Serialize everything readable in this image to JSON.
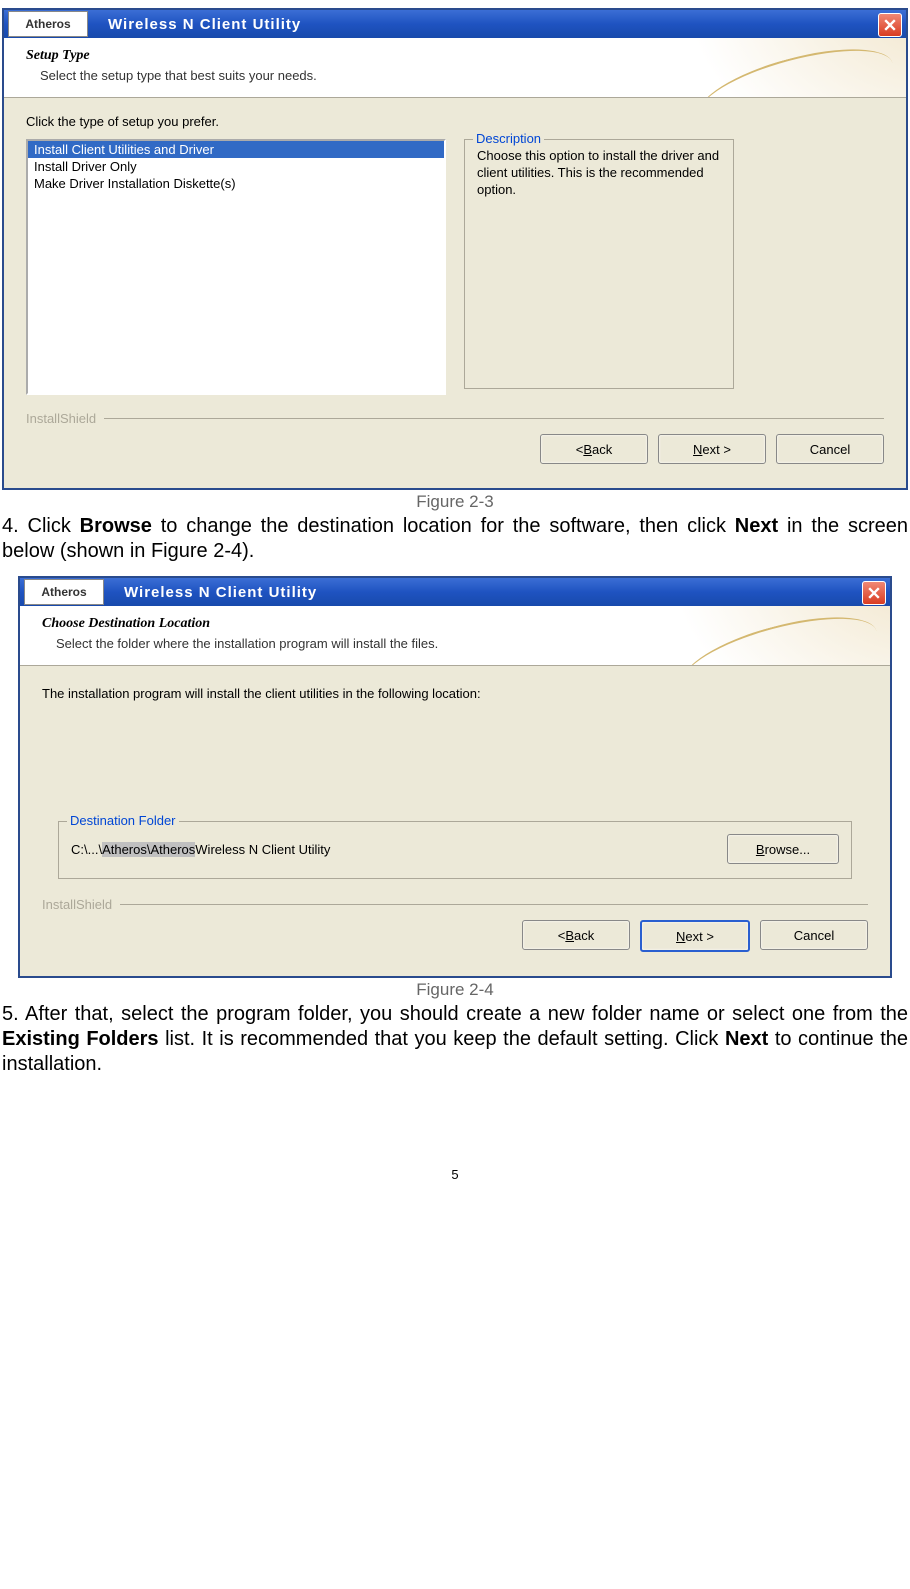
{
  "dialog1": {
    "brand": "Atheros",
    "title": "Wireless N Client Utility",
    "header_title": "Setup Type",
    "header_sub": "Select the setup type that best suits your needs.",
    "instruction": "Click the type of setup you prefer.",
    "options": {
      "opt0": "Install Client Utilities and Driver",
      "opt1": "Install Driver Only",
      "opt2": "Make Driver Installation Diskette(s)"
    },
    "desc_legend": "Description",
    "desc_text": "Choose this option to install the driver and client utilities. This is the recommended option.",
    "installshield": "InstallShield",
    "back_u": "B",
    "back_rest": "ack",
    "next_u": "N",
    "next_rest": "ext >",
    "cancel": "Cancel"
  },
  "fig1": "Figure 2-3",
  "para1_pre": "4. Click ",
  "para1_b1": "Browse",
  "para1_mid": " to change the destination location for the software, then click ",
  "para1_b2": "Next",
  "para1_post": " in the screen below (shown in Figure 2-4).",
  "dialog2": {
    "brand": "Atheros",
    "title": "Wireless N Client Utility",
    "header_title": "Choose Destination Location",
    "header_sub": "Select the folder where the installation program will install the files.",
    "instruction": "The installation program will install the client utilities in the following location:",
    "dest_legend": "Destination Folder",
    "path_pre": "C:\\...\\ ",
    "path_hl": "Atheros\\Atheros ",
    "path_post": "Wireless N Client Utility",
    "browse_u": "B",
    "browse_pre": "",
    "browse_rest": "rowse...",
    "installshield": "InstallShield",
    "back_u": "B",
    "back_rest": "ack",
    "next_u": "N",
    "next_rest": "ext >",
    "cancel": "Cancel"
  },
  "fig2": "Figure 2-4",
  "para2_pre": "5. After that, select the program folder, you should create a new folder name or select one from the ",
  "para2_b1": "Existing Folders",
  "para2_mid": " list. It is recommended that you keep the default setting. Click ",
  "para2_b2": "Next",
  "para2_post": " to continue the installation.",
  "pagenum": "5"
}
